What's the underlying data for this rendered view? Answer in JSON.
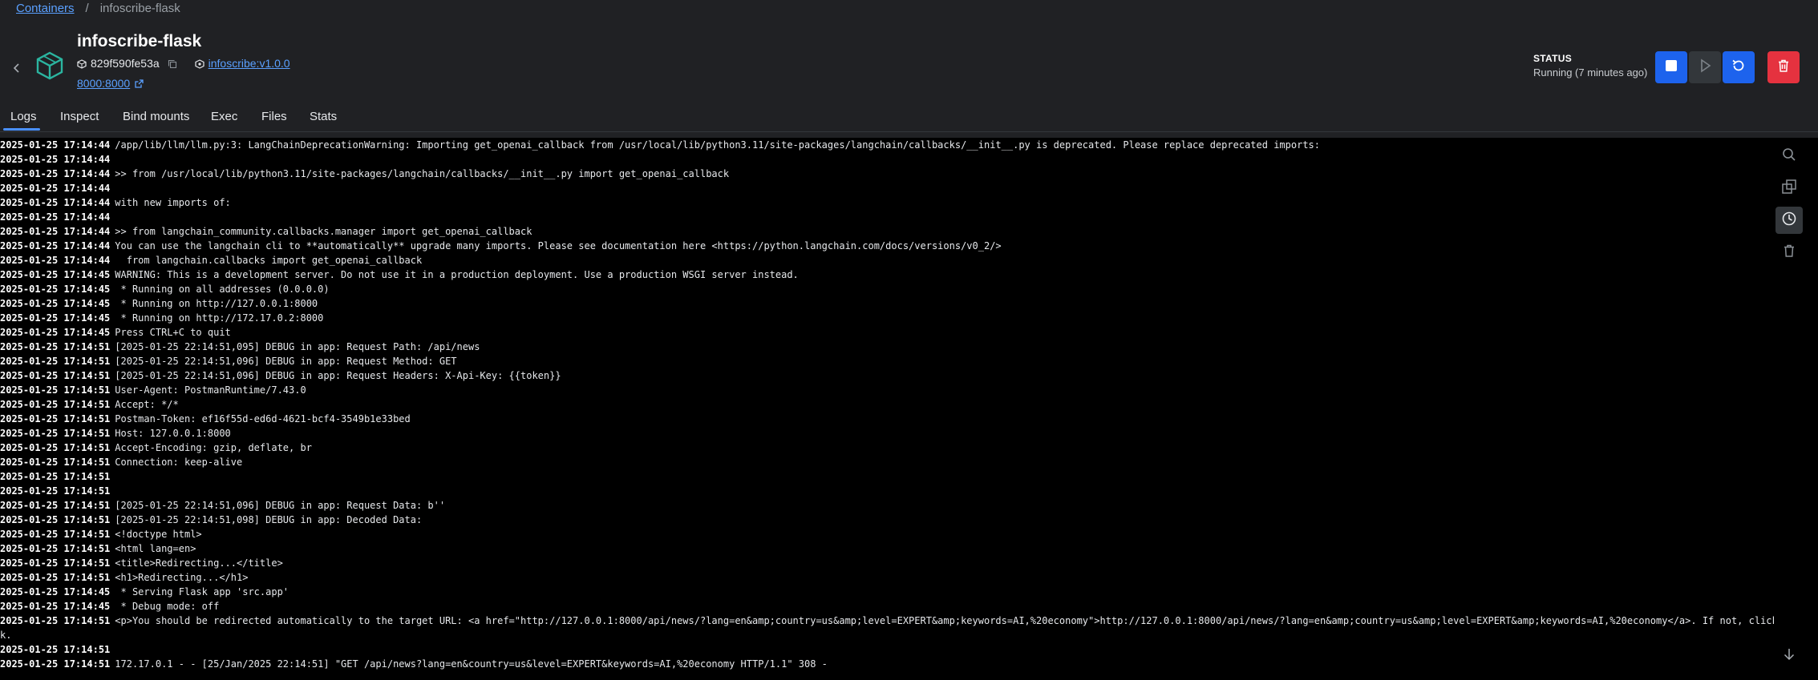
{
  "breadcrumb": {
    "root": "Containers",
    "separator": "/",
    "current": "infoscribe-flask"
  },
  "container": {
    "name": "infoscribe-flask",
    "id": "829f590fe53a",
    "image": "infoscribe:v1.0.0",
    "port": "8000:8000"
  },
  "status": {
    "label": "STATUS",
    "value": "Running (7 minutes ago)"
  },
  "tabs": [
    "Logs",
    "Inspect",
    "Bind mounts",
    "Exec",
    "Files",
    "Stats"
  ],
  "colors": {
    "accent": "#1d63ed",
    "danger": "#e5323f",
    "link": "#5aa0ff",
    "log_bg": "#000000"
  },
  "icons": {
    "back": "chevron-left-icon",
    "container": "container-cube-icon",
    "id": "hash-icon",
    "copy": "copy-icon",
    "image": "image-layers-icon",
    "external": "external-link-icon",
    "stop": "stop-icon",
    "start": "play-icon",
    "restart": "restart-icon",
    "delete": "trash-icon",
    "search": "search-icon",
    "copy_logs": "copy-logs-icon",
    "timestamps": "clock-icon",
    "clear": "clear-trash-icon",
    "scroll_bottom": "arrow-down-icon"
  },
  "logs": [
    {
      "ts": "2025-01-25 17:14:44",
      "msg": "/app/lib/llm/llm.py:3: LangChainDeprecationWarning: Importing get_openai_callback from /usr/local/lib/python3.11/site-packages/langchain/callbacks/__init__.py is deprecated. Please replace deprecated imports:"
    },
    {
      "ts": "2025-01-25 17:14:44",
      "msg": ""
    },
    {
      "ts": "2025-01-25 17:14:44",
      "msg": ">> from /usr/local/lib/python3.11/site-packages/langchain/callbacks/__init__.py import get_openai_callback"
    },
    {
      "ts": "2025-01-25 17:14:44",
      "msg": ""
    },
    {
      "ts": "2025-01-25 17:14:44",
      "msg": "with new imports of:"
    },
    {
      "ts": "2025-01-25 17:14:44",
      "msg": ""
    },
    {
      "ts": "2025-01-25 17:14:44",
      "msg": ">> from langchain_community.callbacks.manager import get_openai_callback"
    },
    {
      "ts": "2025-01-25 17:14:44",
      "msg": "You can use the langchain cli to **automatically** upgrade many imports. Please see documentation here <https://python.langchain.com/docs/versions/v0_2/>"
    },
    {
      "ts": "2025-01-25 17:14:44",
      "msg": "  from langchain.callbacks import get_openai_callback"
    },
    {
      "ts": "2025-01-25 17:14:45",
      "msg": "WARNING: This is a development server. Do not use it in a production deployment. Use a production WSGI server instead."
    },
    {
      "ts": "2025-01-25 17:14:45",
      "msg": " * Running on all addresses (0.0.0.0)"
    },
    {
      "ts": "2025-01-25 17:14:45",
      "msg": " * Running on http://127.0.0.1:8000"
    },
    {
      "ts": "2025-01-25 17:14:45",
      "msg": " * Running on http://172.17.0.2:8000"
    },
    {
      "ts": "2025-01-25 17:14:45",
      "msg": "Press CTRL+C to quit"
    },
    {
      "ts": "2025-01-25 17:14:51",
      "msg": "[2025-01-25 22:14:51,095] DEBUG in app: Request Path: /api/news"
    },
    {
      "ts": "2025-01-25 17:14:51",
      "msg": "[2025-01-25 22:14:51,096] DEBUG in app: Request Method: GET"
    },
    {
      "ts": "2025-01-25 17:14:51",
      "msg": "[2025-01-25 22:14:51,096] DEBUG in app: Request Headers: X-Api-Key: {{token}}"
    },
    {
      "ts": "2025-01-25 17:14:51",
      "msg": "User-Agent: PostmanRuntime/7.43.0"
    },
    {
      "ts": "2025-01-25 17:14:51",
      "msg": "Accept: */*"
    },
    {
      "ts": "2025-01-25 17:14:51",
      "msg": "Postman-Token: ef16f55d-ed6d-4621-bcf4-3549b1e33bed"
    },
    {
      "ts": "2025-01-25 17:14:51",
      "msg": "Host: 127.0.0.1:8000"
    },
    {
      "ts": "2025-01-25 17:14:51",
      "msg": "Accept-Encoding: gzip, deflate, br"
    },
    {
      "ts": "2025-01-25 17:14:51",
      "msg": "Connection: keep-alive"
    },
    {
      "ts": "2025-01-25 17:14:51",
      "msg": ""
    },
    {
      "ts": "2025-01-25 17:14:51",
      "msg": ""
    },
    {
      "ts": "2025-01-25 17:14:51",
      "msg": "[2025-01-25 22:14:51,096] DEBUG in app: Request Data: b''"
    },
    {
      "ts": "2025-01-25 17:14:51",
      "msg": "[2025-01-25 22:14:51,098] DEBUG in app: Decoded Data:"
    },
    {
      "ts": "2025-01-25 17:14:51",
      "msg": "<!doctype html>"
    },
    {
      "ts": "2025-01-25 17:14:51",
      "msg": "<html lang=en>"
    },
    {
      "ts": "2025-01-25 17:14:51",
      "msg": "<title>Redirecting...</title>"
    },
    {
      "ts": "2025-01-25 17:14:51",
      "msg": "<h1>Redirecting...</h1>"
    },
    {
      "ts": "2025-01-25 17:14:45",
      "msg": " * Serving Flask app 'src.app'"
    },
    {
      "ts": "2025-01-25 17:14:45",
      "msg": " * Debug mode: off"
    },
    {
      "ts": "2025-01-25 17:14:51",
      "msg": "<p>You should be redirected automatically to the target URL: <a href=\"http://127.0.0.1:8000/api/news/?lang=en&amp;country=us&amp;level=EXPERT&amp;keywords=AI,%20economy\">http://127.0.0.1:8000/api/news/?lang=en&amp;country=us&amp;level=EXPERT&amp;keywords=AI,%20economy</a>. If not, click the lin"
    },
    {
      "ts": "",
      "msg": "k."
    },
    {
      "ts": "2025-01-25 17:14:51",
      "msg": ""
    },
    {
      "ts": "2025-01-25 17:14:51",
      "msg": "172.17.0.1 - - [25/Jan/2025 22:14:51] \"GET /api/news?lang=en&country=us&level=EXPERT&keywords=AI,%20economy HTTP/1.1\" 308 -"
    }
  ]
}
